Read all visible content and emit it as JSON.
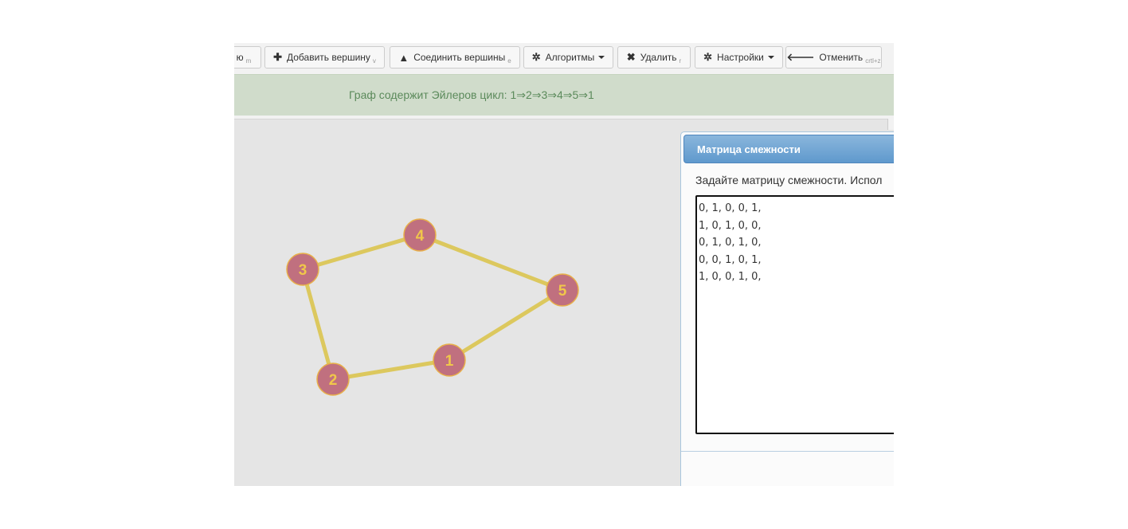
{
  "toolbar": {
    "partial_button": {
      "label": "ю",
      "hotkey": "m"
    },
    "add_vertex": {
      "label": "Добавить вершину",
      "hotkey": "v",
      "icon": "plus-icon"
    },
    "connect_vertices": {
      "label": "Соединить вершины",
      "hotkey": "e",
      "icon": "road-icon"
    },
    "algorithms": {
      "label": "Алгоритмы",
      "icon": "gear-icon"
    },
    "delete": {
      "label": "Удалить",
      "hotkey": "r",
      "icon": "close-icon"
    },
    "settings": {
      "label": "Настройки",
      "icon": "gear-icon"
    },
    "undo": {
      "label": "Отменить",
      "hotkey": "crtl+z",
      "icon": "arrow-left-icon"
    }
  },
  "alert": {
    "message": "Граф содержит Эйлеров цикл: 1⇒2⇒3⇒4⇒5⇒1"
  },
  "graph": {
    "vertex_color": "#c0707f",
    "label_color": "#f0c74a",
    "edge_color": "#dcc85e",
    "vertices": [
      {
        "id": "1",
        "label": "1"
      },
      {
        "id": "2",
        "label": "2"
      },
      {
        "id": "3",
        "label": "3"
      },
      {
        "id": "4",
        "label": "4"
      },
      {
        "id": "5",
        "label": "5"
      }
    ],
    "edges": [
      [
        "1",
        "2"
      ],
      [
        "2",
        "3"
      ],
      [
        "3",
        "4"
      ],
      [
        "4",
        "5"
      ],
      [
        "5",
        "1"
      ]
    ]
  },
  "dialog": {
    "title": "Матрица смежности",
    "description": "Задайте матрицу смежности. Испол",
    "matrix_text": "0, 1, 0, 0, 1,\n1, 0, 1, 0, 0,\n0, 1, 0, 1, 0,\n0, 0, 1, 0, 1,\n1, 0, 0, 1, 0,"
  }
}
